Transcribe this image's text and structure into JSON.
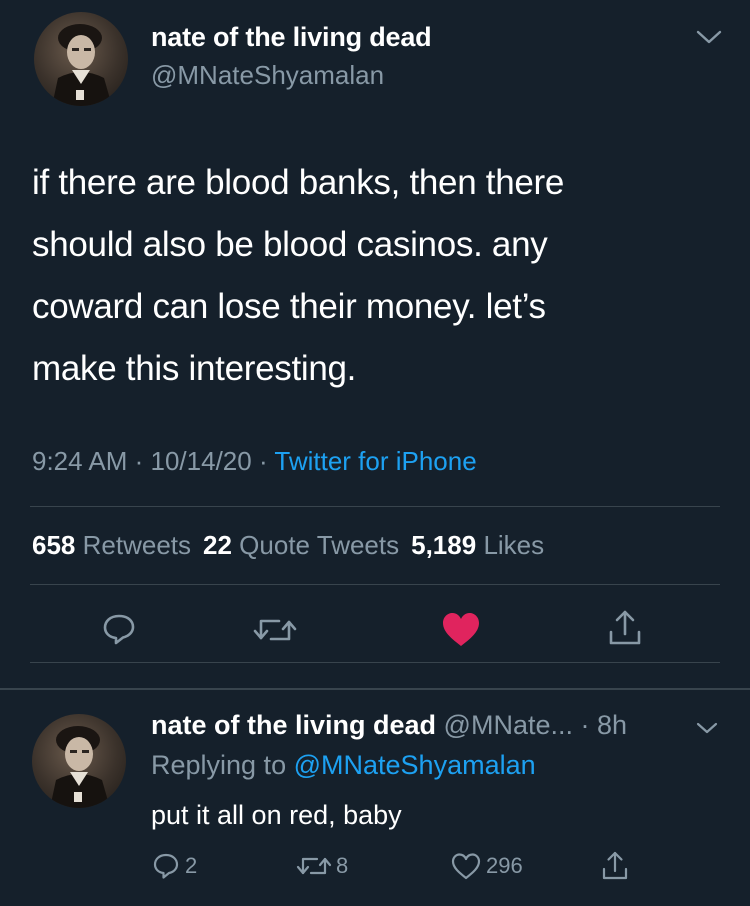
{
  "main_tweet": {
    "display_name": "nate of the living dead",
    "handle": "@MNateShyamalan",
    "text": "if there are blood banks, then there\nshould also be blood casinos. any\ncoward can lose their money. let’s\nmake this interesting.",
    "time": "9:24 AM",
    "date": "10/14/20",
    "separator": " · ",
    "source": "Twitter for iPhone",
    "stats": {
      "retweets_count": "658",
      "retweets_label": "Retweets",
      "quotes_count": "22",
      "quotes_label": "Quote Tweets",
      "likes_count": "5,189",
      "likes_label": "Likes"
    },
    "actions": [
      "reply-icon",
      "retweet-icon",
      "heart-filled-icon",
      "share-icon"
    ]
  },
  "reply_tweet": {
    "display_name": "nate of the living dead",
    "handle": "@MNate...",
    "time_ago": "· 8h",
    "replying_prefix": "Replying to",
    "replying_to": "@MNateShyamalan",
    "text": "put it all on red, baby",
    "reply_count": "2",
    "retweet_count": "8",
    "like_count": "296"
  },
  "colors": {
    "background": "#15202b",
    "secondary_text": "#8899a6",
    "link": "#1da1f2",
    "like_red": "#e0245e",
    "divider": "#38444d"
  }
}
